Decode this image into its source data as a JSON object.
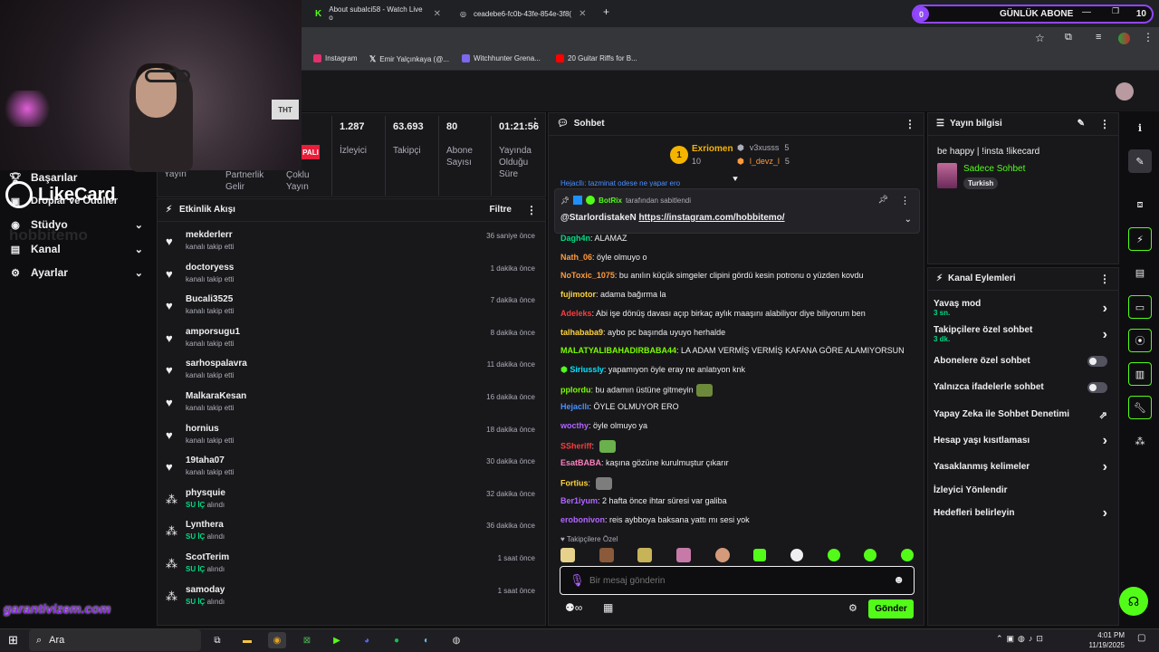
{
  "browser": {
    "tabs": [
      {
        "title": "About subalci58 - Watch Live o"
      },
      {
        "title": "ceadebe6-fc0b-43fe-854e-3f8("
      }
    ],
    "bookmarks": [
      {
        "label": "Instagram",
        "color": "#e1306c"
      },
      {
        "label": "Emir Yalçınkaya (@...",
        "color": "#ffffff"
      },
      {
        "label": "Witchhunter Grena...",
        "color": "#7b68ee"
      },
      {
        "label": "20 Guitar Riffs for B...",
        "color": "#ff0000"
      }
    ]
  },
  "goal": {
    "count": "0",
    "label": "GÜNLÜK ABONE",
    "target": "10"
  },
  "overlay": {
    "brand": "LikeCard",
    "watermark": "hobbitemo",
    "garanti": "garantivizem.com"
  },
  "sidebar": {
    "items": [
      {
        "label": "Başarılar",
        "icon": "trophy-icon"
      },
      {
        "label": "Droplar ve Ödüller",
        "icon": "gift-icon"
      },
      {
        "label": "Stüdyo",
        "icon": "studio-icon"
      },
      {
        "label": "Kanal",
        "icon": "channel-icon"
      },
      {
        "label": "Ayarlar",
        "icon": "gear-icon"
      }
    ]
  },
  "stats": {
    "badge": "PALI",
    "left_labels": [
      "Yayın",
      "Partnerlik Gelir",
      "Çoklu Yayın"
    ],
    "items": [
      {
        "value": "1.287",
        "label": "İzleyici"
      },
      {
        "value": "63.693",
        "label": "Takipçi"
      },
      {
        "value": "80",
        "label": "Abone Sayısı"
      },
      {
        "value": "01:21:56",
        "label": "Yayında Olduğu Süre"
      }
    ]
  },
  "activity": {
    "title": "Etkinlik Akışı",
    "filter": "Filtre",
    "items": [
      {
        "name": "mekderlerr",
        "action": "kanalı takip etti",
        "time": "36 saniye önce",
        "type": "follow"
      },
      {
        "name": "doctoryess",
        "action": "kanalı takip etti",
        "time": "1 dakika önce",
        "type": "follow"
      },
      {
        "name": "Bucali3525",
        "action": "kanalı takip etti",
        "time": "7 dakika önce",
        "type": "follow"
      },
      {
        "name": "amporsugu1",
        "action": "kanalı takip etti",
        "time": "8 dakika önce",
        "type": "follow"
      },
      {
        "name": "sarhospalavra",
        "action": "kanalı takip etti",
        "time": "11 dakika önce",
        "type": "follow"
      },
      {
        "name": "MalkaraKesan",
        "action": "kanalı takip etti",
        "time": "16 dakika önce",
        "type": "follow"
      },
      {
        "name": "hornius",
        "action": "kanalı takip etti",
        "time": "18 dakika önce",
        "type": "follow"
      },
      {
        "name": "19taha07",
        "action": "kanalı takip etti",
        "time": "30 dakika önce",
        "type": "follow"
      },
      {
        "name": "physquie",
        "highlight": "SU İÇ",
        "action": "alındı",
        "time": "32 dakika önce",
        "type": "reward"
      },
      {
        "name": "Lynthera",
        "highlight": "SU İÇ",
        "action": "alındı",
        "time": "36 dakika önce",
        "type": "reward"
      },
      {
        "name": "ScotTerim",
        "highlight": "SU İÇ",
        "action": "alındı",
        "time": "1 saat önce",
        "type": "reward"
      },
      {
        "name": "samoday",
        "highlight": "SU İÇ",
        "action": "alındı",
        "time": "1 saat önce",
        "type": "reward"
      }
    ]
  },
  "chat": {
    "title": "Sohbet",
    "leaderboard": {
      "first": {
        "rank": "1",
        "name": "Exriomen",
        "count": "10"
      },
      "others": [
        {
          "name": "v3xusss",
          "count": "5"
        },
        {
          "name": "l_devz_l",
          "count": "5"
        }
      ]
    },
    "pinned": {
      "by_name": "BotRix",
      "by_suffix": "tarafından sabitlendi",
      "mention": "@StarlordistakeN",
      "link": "https://instagram.com/hobbitemo/"
    },
    "partial_top": "Hejacllı: tazminat odese ne yapar ero",
    "messages": [
      {
        "user": "Dagh4n",
        "color": "#00db84",
        "text": "ALAMAZ"
      },
      {
        "user": "Nath_06",
        "color": "#ff9a3c",
        "text": "öyle olmuyo o"
      },
      {
        "user": "NoToxic_1075",
        "color": "#ff9a3c",
        "text": "bu anılın küçük simgeler clipini gördü kesin potronu o yüzden kovdu"
      },
      {
        "user": "fujimotor",
        "color": "#ffd43b",
        "text": "adama bağırma la"
      },
      {
        "user": "Adeleks",
        "color": "#ff3b3b",
        "text": "Abi işe dönüş davası açıp birkaç aylık maaşını alabiliyor diye biliyorum ben"
      },
      {
        "user": "talhababa9",
        "color": "#ffd43b",
        "text": "aybo pc başında uyuyo herhalde"
      },
      {
        "user": "MALATYALIBAHADIRBABA44",
        "color": "#7cfc00",
        "text": "LA ADAM VERMİŞ VERMİŞ KAFANA GÖRE ALAMIYORSUN"
      },
      {
        "user": "Siriussly",
        "color": "#00e5ff",
        "text": "yapamıyon öyle eray ne anlatıyon knk"
      },
      {
        "user": "pplordu",
        "color": "#7cfc00",
        "text": "bu adamın üstüne gitmeyin"
      },
      {
        "user": "Hejacllı",
        "color": "#4a90ff",
        "text": "ÖYLE OLMUYOR ERO"
      },
      {
        "user": "wocthy",
        "color": "#b266ff",
        "text": "öyle olmuyo ya"
      },
      {
        "user": "SSheriff",
        "color": "#ff3b3b",
        "text": ""
      },
      {
        "user": "EsatBABA",
        "color": "#ff80c0",
        "text": "kaşına gözüne kurulmuştur çıkarır"
      },
      {
        "user": "Fortius",
        "color": "#ffd43b",
        "text": ""
      },
      {
        "user": "Ber1iyum",
        "color": "#b266ff",
        "text": "2 hafta önce ihtar süresi var galiba"
      },
      {
        "user": "erobonivon",
        "color": "#b266ff",
        "text": "reis aybboya baksana yattı mı sesi yok"
      }
    ],
    "follower_label": "Takipçilere Özel",
    "input_placeholder": "Bir mesaj gönderin",
    "send": "Gönder"
  },
  "stream_info": {
    "title": "Yayın bilgisi",
    "stream_title": "be happy | !insta !likecard",
    "category": "Sadece Sohbet",
    "tag": "Turkish"
  },
  "channel_actions": {
    "title": "Kanal Eylemleri",
    "items": [
      {
        "label": "Yavaş mod",
        "sub": "3 sn.",
        "control": "arrow"
      },
      {
        "label": "Takipçilere özel sohbet",
        "sub": "3 dk.",
        "control": "arrow"
      },
      {
        "label": "Abonelere özel sohbet",
        "sub": "",
        "control": "toggle"
      },
      {
        "label": "Yalnızca ifadelerle sohbet",
        "sub": "",
        "control": "toggle"
      },
      {
        "label": "Yapay Zeka ile Sohbet Denetimi",
        "sub": "",
        "control": "external"
      },
      {
        "label": "Hesap yaşı kısıtlaması",
        "sub": "",
        "control": "arrow"
      },
      {
        "label": "Yasaklanmış kelimeler",
        "sub": "",
        "control": "arrow"
      },
      {
        "label": "İzleyici Yönlendir",
        "sub": "",
        "control": "none"
      },
      {
        "label": "Hedefleri belirleyin",
        "sub": "",
        "control": "arrow"
      }
    ]
  },
  "taskbar": {
    "search": "Ara",
    "time": "4:01 PM",
    "date": "11/19/2025"
  },
  "colors": {
    "accent": "#9146ff",
    "kick_green": "#53fc18",
    "panel": "#18181b",
    "bg": "#0e0e10"
  }
}
